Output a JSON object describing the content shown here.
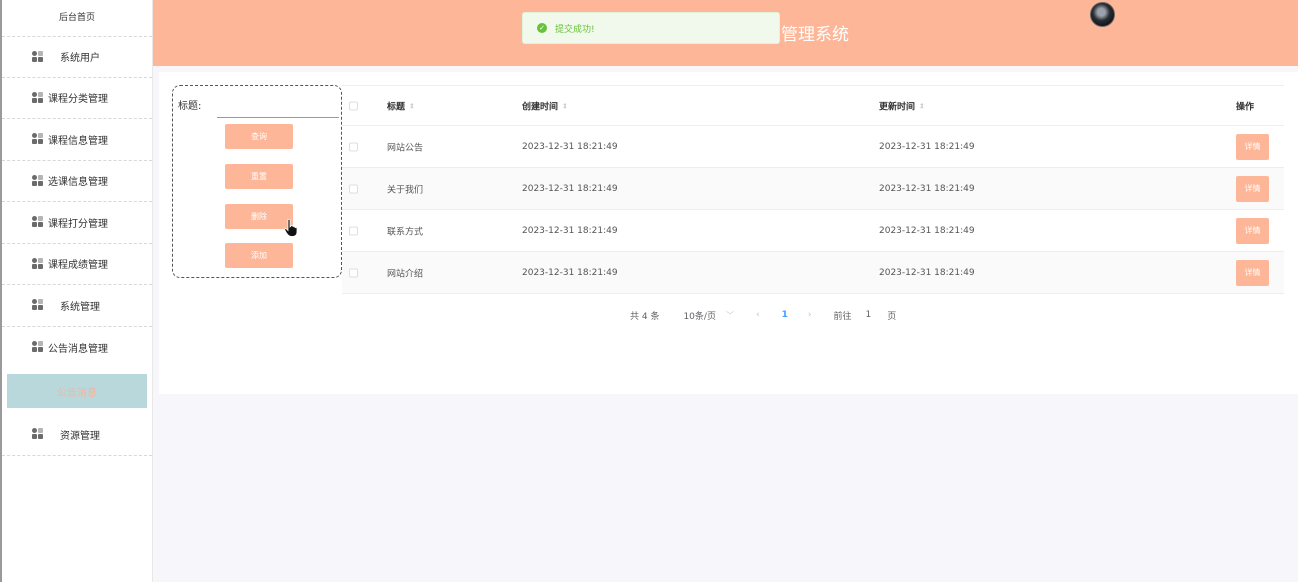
{
  "sidebar": {
    "home": "后台首页",
    "items": [
      {
        "label": "系统用户"
      },
      {
        "label": "课程分类管理"
      },
      {
        "label": "课程信息管理"
      },
      {
        "label": "选课信息管理"
      },
      {
        "label": "课程打分管理"
      },
      {
        "label": "课程成绩管理"
      },
      {
        "label": "系统管理"
      },
      {
        "label": "公告消息管理"
      }
    ],
    "active": "公告消息",
    "last": "资源管理"
  },
  "header": {
    "title": "管理系统",
    "toast": "提交成功!"
  },
  "search": {
    "label": "标题:",
    "value": "",
    "buttons": {
      "query": "查询",
      "reset": "重置",
      "delete": "删除",
      "add": "添加"
    }
  },
  "table": {
    "columns": {
      "title": "标题",
      "created": "创建时间",
      "updated": "更新时间",
      "op": "操作"
    },
    "rows": [
      {
        "title": "网站公告",
        "created": "2023-12-31 18:21:49",
        "updated": "2023-12-31 18:21:49",
        "action": "详情"
      },
      {
        "title": "关于我们",
        "created": "2023-12-31 18:21:49",
        "updated": "2023-12-31 18:21:49",
        "action": "详情"
      },
      {
        "title": "联系方式",
        "created": "2023-12-31 18:21:49",
        "updated": "2023-12-31 18:21:49",
        "action": "详情"
      },
      {
        "title": "网站介绍",
        "created": "2023-12-31 18:21:49",
        "updated": "2023-12-31 18:21:49",
        "action": "详情"
      }
    ]
  },
  "pagination": {
    "total": "共 4 条",
    "page_size": "10条/页",
    "current": "1",
    "goto_label": "前往",
    "goto_value": "1",
    "page_suffix": "页"
  },
  "colors": {
    "accent": "#fdb798",
    "active_bg": "#b9d8dc",
    "success": "#67c23a",
    "link": "#409eff"
  }
}
